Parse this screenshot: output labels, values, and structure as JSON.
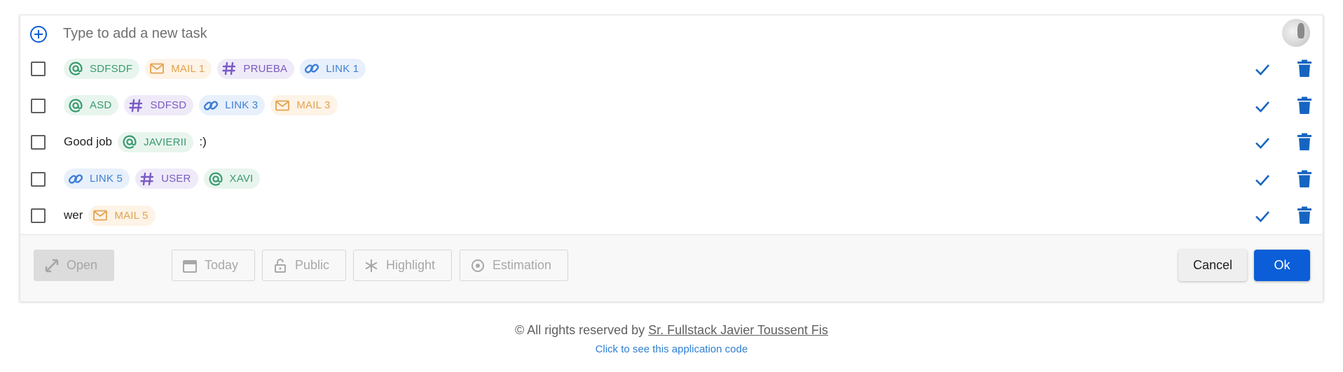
{
  "input": {
    "placeholder": "Type to add a new task"
  },
  "colors": {
    "accent": "#0b5ed7",
    "mention": "#3a9a6e",
    "mail": "#e3a24f",
    "tag": "#7a5bc4",
    "link": "#3d7fd6"
  },
  "tasks": [
    {
      "items": [
        {
          "kind": "mention",
          "icon": "at-icon",
          "text": "SDFSDF"
        },
        {
          "kind": "mail",
          "icon": "mail-icon",
          "text": "MAIL 1"
        },
        {
          "kind": "tag",
          "icon": "hash-icon",
          "text": "PRUEBA"
        },
        {
          "kind": "link",
          "icon": "link-icon",
          "text": "LINK 1"
        }
      ]
    },
    {
      "items": [
        {
          "kind": "mention",
          "icon": "at-icon",
          "text": "ASD"
        },
        {
          "kind": "tag",
          "icon": "hash-icon",
          "text": "SDFSD"
        },
        {
          "kind": "link",
          "icon": "link-icon",
          "text": "LINK 3"
        },
        {
          "kind": "mail",
          "icon": "mail-icon",
          "text": "MAIL 3"
        }
      ]
    },
    {
      "items": [
        {
          "kind": "text",
          "text": "Good job"
        },
        {
          "kind": "mention",
          "icon": "at-icon",
          "text": "JAVIERII"
        },
        {
          "kind": "text",
          "text": ":)"
        }
      ]
    },
    {
      "items": [
        {
          "kind": "link",
          "icon": "link-icon",
          "text": "LINK 5"
        },
        {
          "kind": "tag",
          "icon": "hash-icon",
          "text": "USER"
        },
        {
          "kind": "mention",
          "icon": "at-icon",
          "text": "XAVI"
        }
      ]
    },
    {
      "items": [
        {
          "kind": "text",
          "text": "wer"
        },
        {
          "kind": "mail",
          "icon": "mail-icon",
          "text": "MAIL 5"
        }
      ]
    }
  ],
  "toolbar": {
    "open_label": "Open",
    "options": [
      {
        "label": "Today",
        "icon": "calendar-icon"
      },
      {
        "label": "Public",
        "icon": "lock-open-icon"
      },
      {
        "label": "Highlight",
        "icon": "snowflake-icon"
      },
      {
        "label": "Estimation",
        "icon": "target-icon"
      }
    ],
    "cancel_label": "Cancel",
    "ok_label": "Ok"
  },
  "footer": {
    "copyright_prefix": "© All rights reserved by",
    "author": "Sr. Fullstack Javier Toussent Fis",
    "code_link": "Click to see this application code"
  }
}
